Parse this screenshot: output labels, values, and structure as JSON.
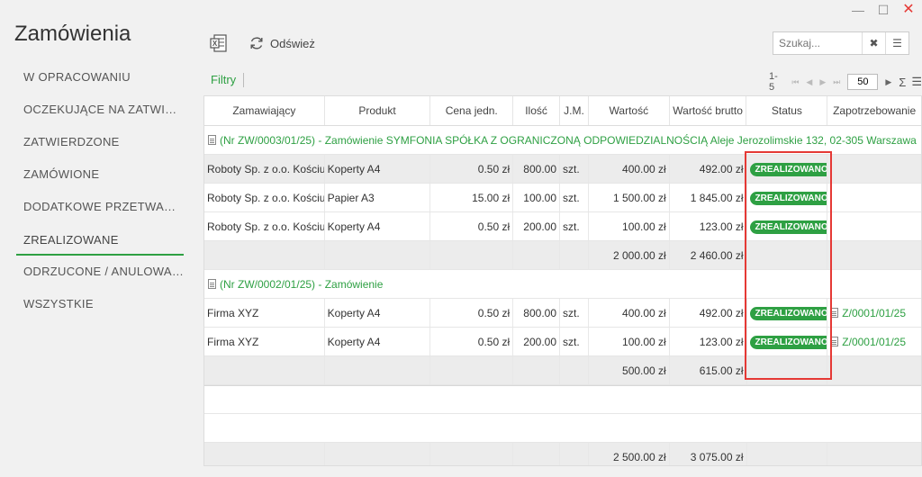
{
  "window": {
    "minimize": "—",
    "maximize": "☐",
    "close": "✕"
  },
  "page_title": "Zamówienia",
  "sidebar": {
    "items": [
      {
        "label": "W OPRACOWANIU"
      },
      {
        "label": "OCZEKUJĄCE NA ZATWIERDZENIE"
      },
      {
        "label": "ZATWIERDZONE"
      },
      {
        "label": "ZAMÓWIONE"
      },
      {
        "label": "DODATKOWE PRZETWARZANIE"
      },
      {
        "label": "ZREALIZOWANE",
        "active": true
      },
      {
        "label": "ODRZUCONE / ANULOWANE"
      },
      {
        "label": "WSZYSTKIE"
      }
    ]
  },
  "toolbar": {
    "excel_icon": "excel-export-icon",
    "refresh_label": "Odśwież"
  },
  "search": {
    "placeholder": "Szukaj...",
    "clear": "✖",
    "menu": "☰"
  },
  "filters": {
    "label": "Filtry"
  },
  "pager": {
    "range": "1-5",
    "page_size": "50",
    "sigma": "Σ",
    "columns": "☰"
  },
  "grid": {
    "columns": [
      "Zamawiający",
      "Produkt",
      "Cena jedn.",
      "Ilość",
      "J.M.",
      "Wartość",
      "Wartość brutto",
      "Status",
      "Zapotrzebowanie"
    ],
    "groups": [
      {
        "title": "(Nr ZW/0003/01/25) - Zamówienie SYMFONIA SPÓŁKA Z OGRANICZONĄ ODPOWIEDZIALNOŚCIĄ Aleje Jerozolimskie 132, 02-305 Warszawa",
        "rows": [
          {
            "ordering": "Roboty Sp. z o.o. Kościuszki",
            "product": "Koperty A4",
            "price": "0.50 zł",
            "qty": "800.00",
            "unit": "szt.",
            "value": "400.00 zł",
            "gross": "492.00 zł",
            "status": "ZREALIZOWANO",
            "req": ""
          },
          {
            "ordering": "Roboty Sp. z o.o. Kościuszki",
            "product": "Papier A3",
            "price": "15.00 zł",
            "qty": "100.00",
            "unit": "szt.",
            "value": "1 500.00 zł",
            "gross": "1 845.00 zł",
            "status": "ZREALIZOWANO",
            "req": ""
          },
          {
            "ordering": "Roboty Sp. z o.o. Kościuszki",
            "product": "Koperty A4",
            "price": "0.50 zł",
            "qty": "200.00",
            "unit": "szt.",
            "value": "100.00 zł",
            "gross": "123.00 zł",
            "status": "ZREALIZOWANO",
            "req": ""
          }
        ],
        "sum_value": "2 000.00 zł",
        "sum_gross": "2 460.00 zł"
      },
      {
        "title": "(Nr ZW/0002/01/25) - Zamówienie",
        "rows": [
          {
            "ordering": "Firma XYZ",
            "product": "Koperty A4",
            "price": "0.50 zł",
            "qty": "800.00",
            "unit": "szt.",
            "value": "400.00 zł",
            "gross": "492.00 zł",
            "status": "ZREALIZOWANO",
            "req": "Z/0001/01/25"
          },
          {
            "ordering": "Firma XYZ",
            "product": "Koperty A4",
            "price": "0.50 zł",
            "qty": "200.00",
            "unit": "szt.",
            "value": "100.00 zł",
            "gross": "123.00 zł",
            "status": "ZREALIZOWANO",
            "req": "Z/0001/01/25"
          }
        ],
        "sum_value": "500.00 zł",
        "sum_gross": "615.00 zł"
      }
    ],
    "total_value": "2 500.00 zł",
    "total_gross": "3 075.00 zł"
  },
  "colors": {
    "accent": "#2ea043",
    "highlight": "#e53935"
  }
}
